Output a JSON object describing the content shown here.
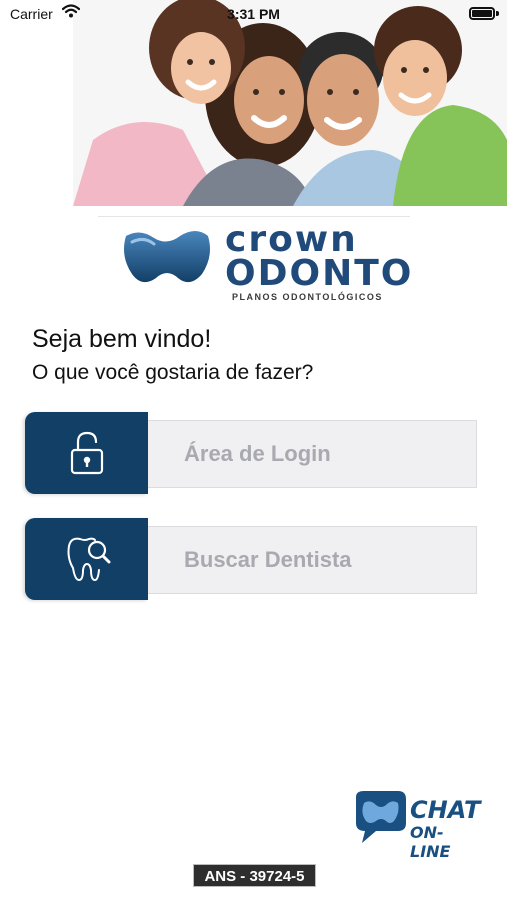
{
  "status_bar": {
    "carrier": "Carrier",
    "time": "3:31 PM",
    "wifi_icon": "wifi-icon",
    "battery_icon": "battery-icon"
  },
  "brand": {
    "name_line1": "crown",
    "name_line2": "ODONTO",
    "tagline": "PLANOS ODONTOLÓGICOS",
    "colors": {
      "primary": "#123f66",
      "logo_blue": "#1f4a7a"
    }
  },
  "welcome": {
    "title": "Seja bem vindo!",
    "question": "O que você gostaria de fazer?"
  },
  "menu": [
    {
      "label": "Área de Login",
      "icon": "padlock-icon"
    },
    {
      "label": "Buscar Dentista",
      "icon": "tooth-search-icon"
    }
  ],
  "chat": {
    "line1": "CHAT",
    "line2": "ON-LINE",
    "icon": "chat-bubble-icon"
  },
  "ans": "ANS - 39724-5"
}
